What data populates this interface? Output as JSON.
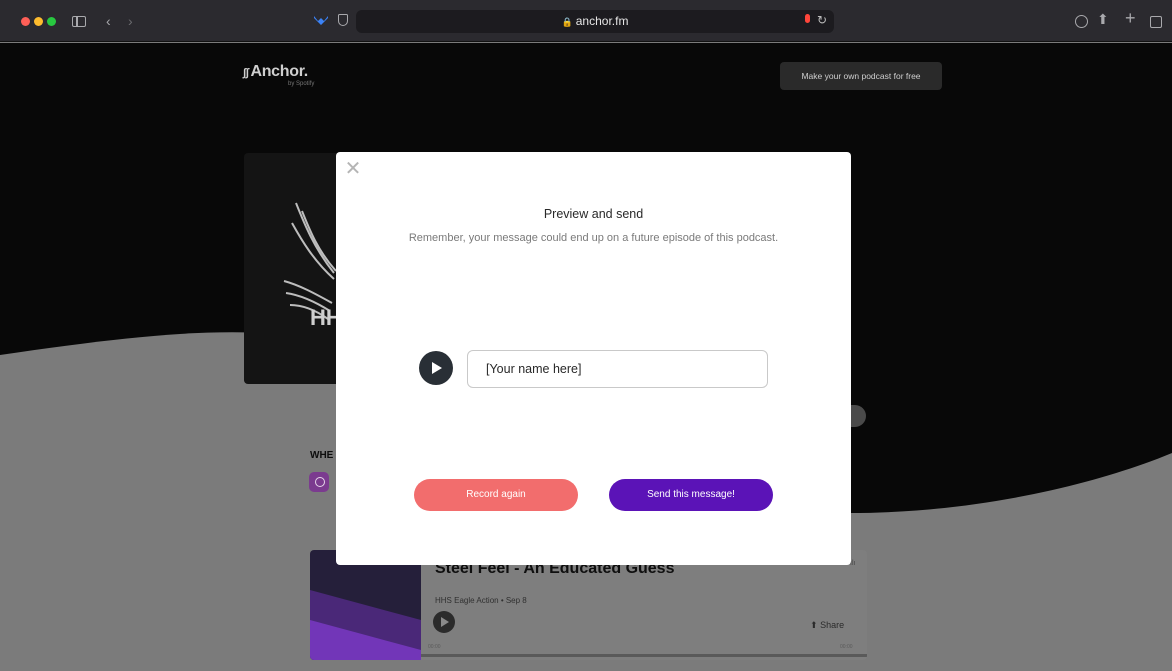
{
  "browser": {
    "url": "anchor.fm"
  },
  "site": {
    "logo": "Anchor.",
    "logo_sub": "by Spotify",
    "cta": "Make your own podcast for free",
    "cover_text": "HH",
    "where_label": "WHE"
  },
  "episode": {
    "title": "Steel Feel - An Educated Guess",
    "meta": "HHS Eagle Action • Sep 8",
    "share_label": "Share",
    "time_start": "00:00",
    "time_end": "00:00"
  },
  "modal": {
    "title": "Preview and send",
    "subtitle": "Remember, your message could end up on a future episode of this podcast.",
    "name_input_value": "[Your name here]",
    "record_again": "Record again",
    "send": "Send this message!"
  },
  "colors": {
    "record_button": "#f26d6d",
    "send_button": "#5b13b7",
    "play_button": "#292f36"
  },
  "icons": {
    "close": "close-icon",
    "play": "play-icon",
    "lock": "lock-icon",
    "share": "share-icon"
  }
}
